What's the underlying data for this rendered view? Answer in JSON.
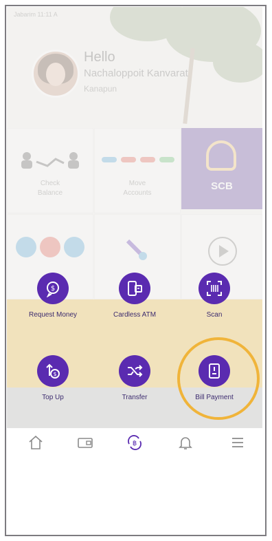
{
  "background": {
    "status_time": "Jabarim 11:11 A",
    "greeting": "Hello",
    "user_name": "Nachaloppoit Kanvarat",
    "account_label": "Kanapun",
    "tiles": [
      {
        "label_1": "Check",
        "label_2": "Balance"
      },
      {
        "label_1": "Move",
        "label_2": "Accounts"
      }
    ],
    "brand_tile_text": "SCB"
  },
  "actions": [
    {
      "label": "Request Money",
      "icon": "request-money-icon"
    },
    {
      "label": "Cardless ATM",
      "icon": "cardless-atm-icon"
    },
    {
      "label": "Scan",
      "icon": "scan-icon"
    },
    {
      "label": "Top Up",
      "icon": "top-up-icon"
    },
    {
      "label": "Transfer",
      "icon": "transfer-icon"
    },
    {
      "label": "Bill Payment",
      "icon": "bill-payment-icon"
    }
  ],
  "highlighted_action": "Bill Payment",
  "navbar": [
    "home-icon",
    "wallet-icon",
    "quick-pay-icon",
    "bell-icon",
    "menu-icon"
  ],
  "colors": {
    "primary": "#5a2bb0",
    "highlight_ring": "#f0b43a",
    "overlay_yellow": "#efcf7c",
    "frame": "#7d7b80"
  }
}
